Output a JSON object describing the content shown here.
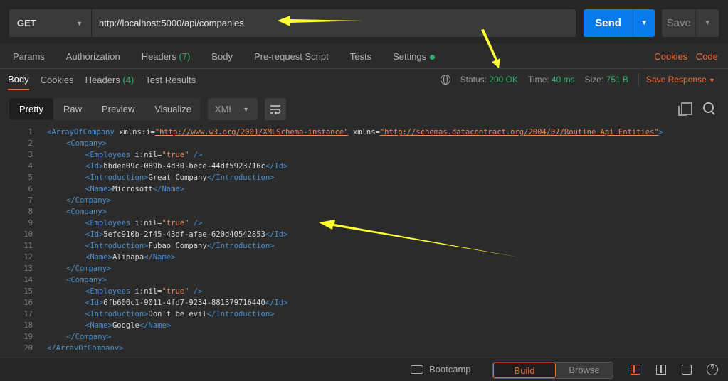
{
  "request": {
    "method": "GET",
    "url": "http://localhost:5000/api/companies",
    "send_label": "Send",
    "save_label": "Save"
  },
  "request_tabs": [
    {
      "label": "Params"
    },
    {
      "label": "Authorization"
    },
    {
      "label": "Headers",
      "count": "(7)"
    },
    {
      "label": "Body"
    },
    {
      "label": "Pre-request Script"
    },
    {
      "label": "Tests"
    },
    {
      "label": "Settings"
    }
  ],
  "request_links": {
    "cookies": "Cookies",
    "code": "Code"
  },
  "response_tabs": [
    {
      "label": "Body"
    },
    {
      "label": "Cookies"
    },
    {
      "label": "Headers",
      "count": "(4)"
    },
    {
      "label": "Test Results"
    }
  ],
  "response_status": {
    "status_label": "Status:",
    "status_value": "200 OK",
    "time_label": "Time:",
    "time_value": "40 ms",
    "size_label": "Size:",
    "size_value": "751 B",
    "save_response": "Save Response"
  },
  "format_modes": [
    "Pretty",
    "Raw",
    "Preview",
    "Visualize"
  ],
  "format_selected": "XML",
  "code_lines": [
    "1",
    "2",
    "3",
    "4",
    "5",
    "6",
    "7",
    "8",
    "9",
    "10",
    "11",
    "12",
    "13",
    "14",
    "15",
    "16",
    "17",
    "18",
    "19",
    "20"
  ],
  "xml": {
    "root_tag": "ArrayOfCompany",
    "ns_i_attr": "xmlns:i",
    "ns_i_val": "\"http://www.w3.org/2001/XMLSchema-instance\"",
    "ns_attr": "xmlns",
    "ns_val": "\"http://schemas.datacontract.org/2004/07/Routine.Api.Entities\"",
    "companies": [
      {
        "id": "bbdee09c-089b-4d30-bece-44df5923716c",
        "intro": "Great Company",
        "name": "Microsoft"
      },
      {
        "id": "5efc910b-2f45-43df-afae-620d40542853",
        "intro": "Fubao Company",
        "name": "Alipapa"
      },
      {
        "id": "6fb600c1-9011-4fd7-9234-881379716440",
        "intro": "Don't be evil",
        "name": "Google"
      }
    ]
  },
  "bottom": {
    "bootcamp": "Bootcamp",
    "build": "Build",
    "browse": "Browse",
    "help": "?"
  },
  "colors": {
    "accent": "#f26b3a",
    "send": "#097bed",
    "ok": "#2db36a",
    "annotation": "#ffff00"
  }
}
